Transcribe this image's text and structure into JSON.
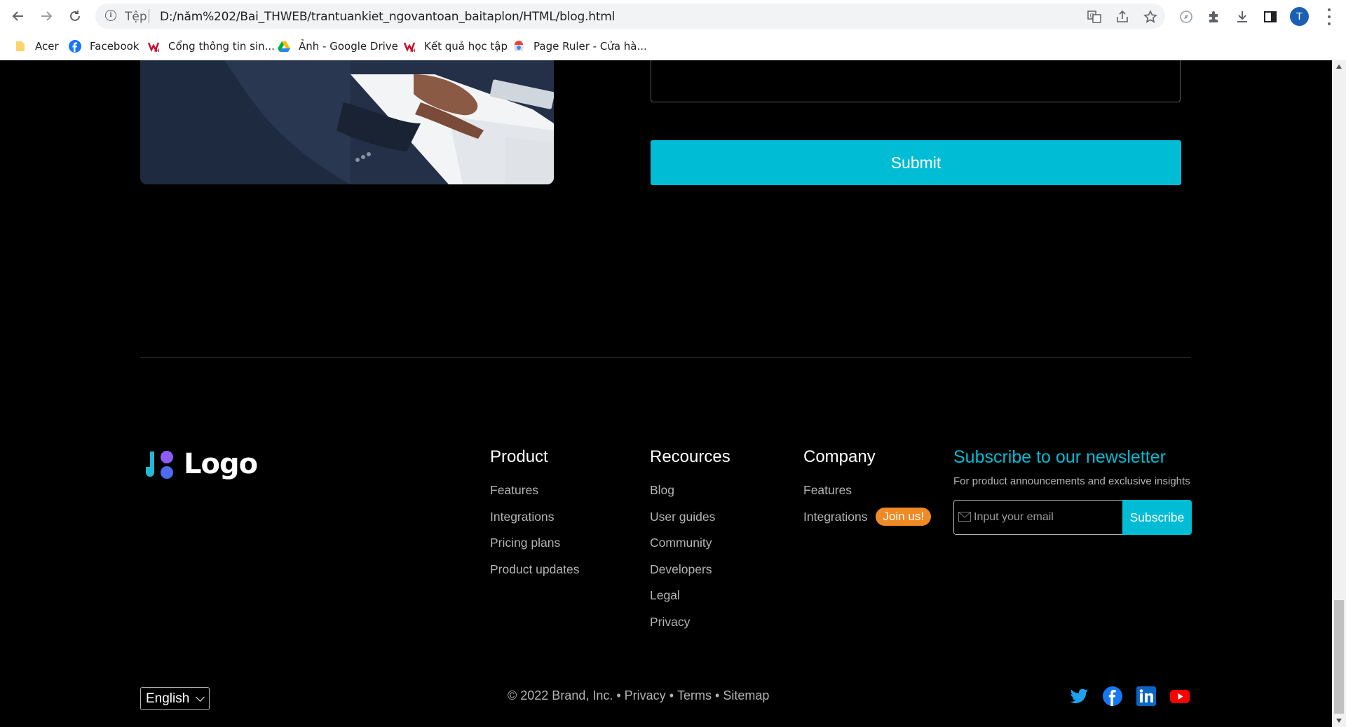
{
  "browser": {
    "scheme_label": "Tệp",
    "url": "D:/năm%202/Bai_THWEB/trantuankiet_ngovantoan_baitaplon/HTML/blog.html",
    "profile_initial": "T"
  },
  "bookmarks": [
    {
      "label": "Acer"
    },
    {
      "label": "Facebook"
    },
    {
      "label": "Cổng thông tin sin..."
    },
    {
      "label": "Ảnh - Google Drive"
    },
    {
      "label": "Kết quả học tập"
    },
    {
      "label": "Page Ruler - Cửa hà..."
    }
  ],
  "form": {
    "submit_label": "Submit"
  },
  "footer": {
    "logo_text": "Logo",
    "columns": [
      {
        "title": "Product",
        "links": [
          "Features",
          "Integrations",
          "Pricing plans",
          "Product updates"
        ]
      },
      {
        "title": "Recources",
        "links": [
          "Blog",
          "User guides",
          "Community",
          "Developers",
          "Legal",
          "Privacy"
        ]
      },
      {
        "title": "Company",
        "links": [
          "Features",
          "Integrations"
        ],
        "badge": "Join us!"
      }
    ],
    "newsletter": {
      "title": "Subscribe to our newsletter",
      "subtitle": "For product announcements and exclusive insights",
      "placeholder": "Input your email",
      "button_label": "Subscribe"
    },
    "language": "English",
    "copyright": "© 2022 Brand, Inc.",
    "legal_links": [
      "Privacy",
      "Terms",
      "Sitemap"
    ],
    "separator": "•"
  },
  "colors": {
    "accent": "#00bcd4",
    "badge": "#f08a24",
    "background": "#000000"
  },
  "icons": {
    "social": [
      "twitter-icon",
      "facebook-icon",
      "linkedin-icon",
      "youtube-icon"
    ]
  }
}
